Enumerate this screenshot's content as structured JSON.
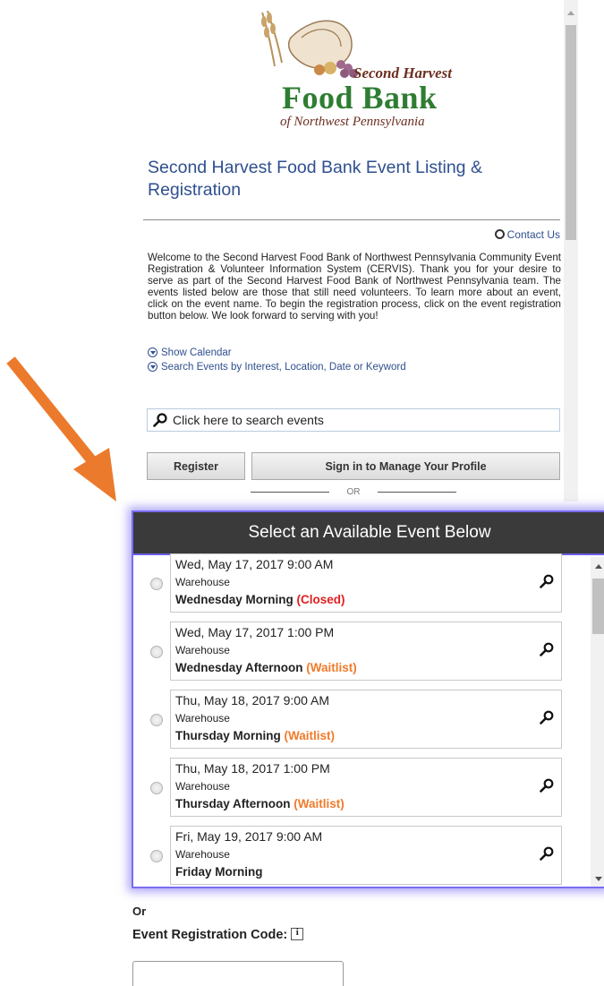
{
  "logo": {
    "line1": "Second Harvest",
    "line2": "Food Bank",
    "line3": "of Northwest Pennsylvania"
  },
  "page_title": "Second Harvest Food Bank Event Listing & Registration",
  "contact_label": "Contact Us",
  "welcome_text": "Welcome to the Second Harvest Food Bank of Northwest Pennsylvania Community Event Registration & Volunteer Information System (CERVIS). Thank you for your desire to serve as part of the Second Harvest Food Bank of Northwest Pennsylvania team. The events listed below are those that still need volunteers. To learn more about an event, click on the event name. To begin the registration process, click on the event registration button below. We look forward to serving with you!",
  "toggles": {
    "calendar": "Show Calendar",
    "search": "Search Events by Interest, Location, Date or Keyword"
  },
  "search": {
    "placeholder": "Click here to search events"
  },
  "buttons": {
    "register": "Register",
    "sign_in": "Sign in to Manage Your Profile",
    "or": "OR"
  },
  "popup": {
    "title": "Select an Available Event Below",
    "events": [
      {
        "date": "Wed, May 17, 2017 9:00 AM",
        "location": "Warehouse",
        "name": "Wednesday Morning",
        "status": "(Closed)",
        "status_color": "#e02020"
      },
      {
        "date": "Wed, May 17, 2017 1:00 PM",
        "location": "Warehouse",
        "name": "Wednesday Afternoon",
        "status": "(Waitlist)",
        "status_color": "#f07a2a"
      },
      {
        "date": "Thu, May 18, 2017 9:00 AM",
        "location": "Warehouse",
        "name": "Thursday Morning",
        "status": "(Waitlist)",
        "status_color": "#f07a2a"
      },
      {
        "date": "Thu, May 18, 2017 1:00 PM",
        "location": "Warehouse",
        "name": "Thursday Afternoon",
        "status": "(Waitlist)",
        "status_color": "#f07a2a"
      },
      {
        "date": "Fri, May 19, 2017 9:00 AM",
        "location": "Warehouse",
        "name": "Friday Morning",
        "status": "",
        "status_color": "#222222"
      }
    ]
  },
  "bottom": {
    "or_label": "Or",
    "code_label": "Event Registration Code:"
  },
  "colors": {
    "accent_arrow": "#ec7a2c",
    "title_blue": "#2f4f8f",
    "popup_glow": "#7a6cf0",
    "header_dark": "#3a3a3a"
  }
}
